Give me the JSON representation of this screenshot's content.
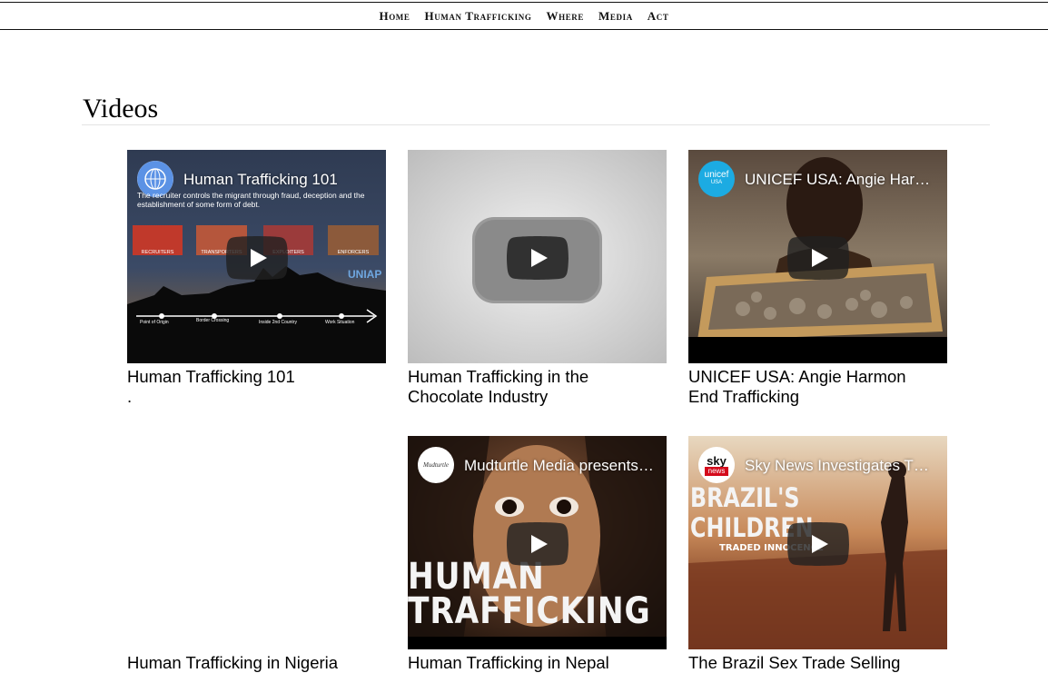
{
  "nav": {
    "items": [
      "Home",
      "Human Trafficking",
      "Where",
      "Media",
      "Act"
    ]
  },
  "section": {
    "title": "Videos"
  },
  "videos": [
    {
      "overlay_title": "Human Trafficking 101",
      "caption_lines": [
        "Human Trafficking 101",
        "."
      ],
      "channel": "un-emblem-icon",
      "thumb_text": {
        "subtitle": "The recruiter controls the migrant through fraud, deception and the establishment of some form of debt.",
        "boxes": [
          "RECRUITERS",
          "TRANSPORTERS",
          "EXPLOITERS",
          "ENFORCERS"
        ],
        "watermark": "UNIAP",
        "timeline": [
          "Point of Origin",
          "Border Crossing",
          "Inside 2nd Country",
          "Work Situation"
        ]
      }
    },
    {
      "overlay_title": "",
      "caption_lines": [
        "Human Trafficking in the",
        "Chocolate Industry"
      ],
      "channel": ""
    },
    {
      "overlay_title": "UNICEF USA: Angie Harmon End Trafficking",
      "caption_lines": [
        "UNICEF USA: Angie Harmon",
        "End Trafficking"
      ],
      "channel": "unicef-logo-icon",
      "channel_text": "unicef",
      "channel_subtext": "USA"
    },
    {
      "overlay_title": "",
      "caption_lines": [
        "Human Trafficking in Nigeria"
      ],
      "channel": ""
    },
    {
      "overlay_title": "Mudturtle Media presents: Human Trafficking",
      "caption_lines": [
        "Human Trafficking in Nepal"
      ],
      "channel": "mudturtle-logo-icon",
      "channel_text": "Mudturtle",
      "thumb_text": {
        "big_lines": [
          "HUMAN",
          "TRAFFICKING"
        ]
      }
    },
    {
      "overlay_title": "Sky News Investigates The Brazil Sex Trade",
      "caption_lines": [
        "The Brazil Sex Trade Selling"
      ],
      "channel": "sky-news-logo-icon",
      "channel_text": "sky",
      "channel_subtext": "news",
      "thumb_text": {
        "big_lines": [
          "BRAZIL'S",
          "CHILDREN"
        ],
        "small": "TRADED INNOCENCE"
      }
    }
  ],
  "colors": {
    "play_button": "#212121",
    "unicef_blue": "#1cabe2",
    "sky_red": "#d40a1b"
  }
}
